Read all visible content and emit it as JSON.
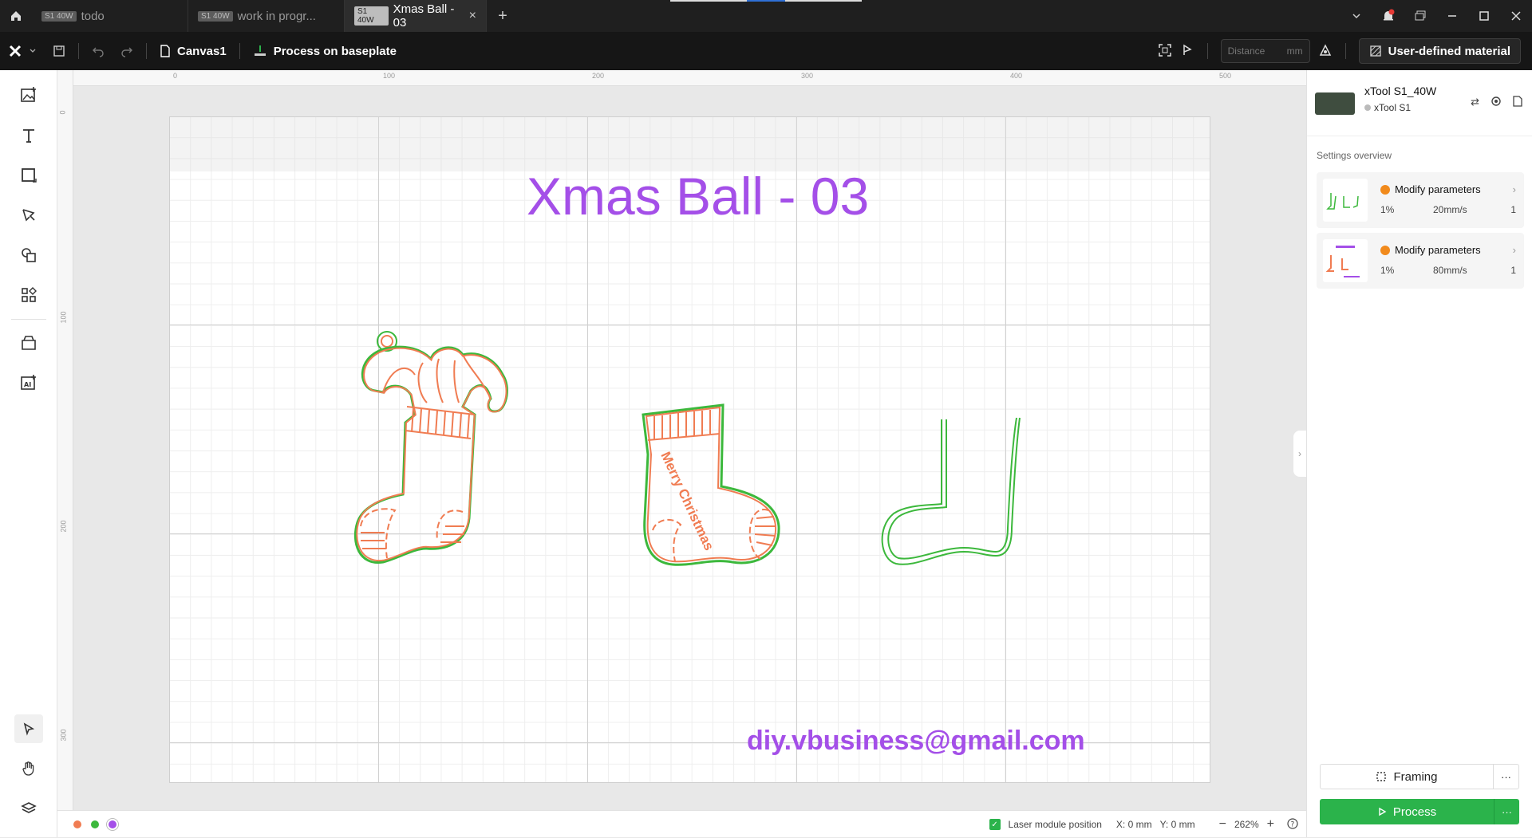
{
  "tabs": [
    {
      "badge": "S1 40W",
      "label": "todo"
    },
    {
      "badge": "S1 40W",
      "label": "work in progr..."
    },
    {
      "badge": "S1 40W",
      "label": "Xmas Ball - 03",
      "active": true
    }
  ],
  "toolbar": {
    "canvas_name": "Canvas1",
    "process_label": "Process on baseplate",
    "distance_placeholder": "Distance",
    "distance_unit": "mm",
    "material_label": "User-defined material"
  },
  "ruler": {
    "top_ticks": [
      "0",
      "100",
      "200",
      "300",
      "400",
      "500"
    ],
    "left_ticks": [
      "0",
      "100",
      "200",
      "300"
    ]
  },
  "canvas": {
    "title": "Xmas Ball - 03",
    "footer_email": "diy.vbusiness@gmail.com",
    "stocking_text": "Merry Christmas"
  },
  "device": {
    "name": "xTool S1_40W",
    "model": "xTool S1"
  },
  "settings": {
    "title": "Settings overview",
    "cards": [
      {
        "label": "Modify parameters",
        "power": "1%",
        "speed": "20mm/s",
        "passes": "1"
      },
      {
        "label": "Modify parameters",
        "power": "1%",
        "speed": "80mm/s",
        "passes": "1"
      }
    ]
  },
  "actions": {
    "framing": "Framing",
    "process": "Process",
    "more": "···"
  },
  "status": {
    "laser_position_label": "Laser module position",
    "x": "X: 0 mm",
    "y": "Y: 0 mm",
    "zoom": "262%",
    "minus": "−",
    "plus": "+"
  },
  "colors": {
    "orange": "#f07c52",
    "green": "#3cb83c",
    "purple": "#a44fe8",
    "accent": "#2bb34b"
  }
}
